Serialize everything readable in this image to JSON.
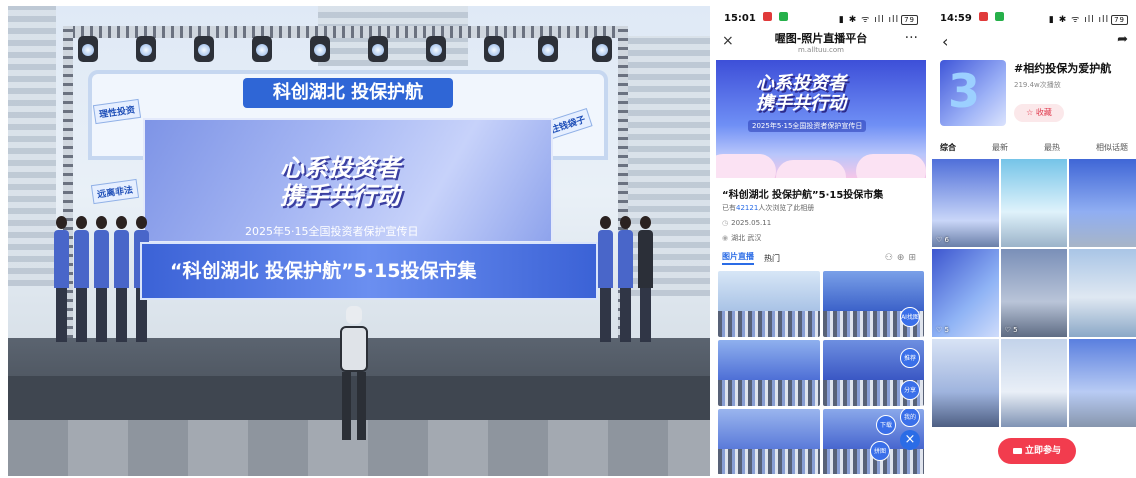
{
  "event_photo": {
    "arch_sign": "科创湖北 投保护航",
    "backdrop_title_line1": "心系投资者",
    "backdrop_title_line2": "携手共行动",
    "backdrop_subtitle": "2025年5·15全国投资者保护宣传日",
    "banner_text": "“科创湖北 投保护航”5·15投保市集",
    "side_tag_left_1": "理性投资",
    "side_tag_left_2": "远离非法",
    "side_tag_right": "守住钱袋子"
  },
  "phone_mid": {
    "status": {
      "time": "15:01",
      "battery": "79"
    },
    "nav": {
      "title": "喔图-照片直播平台",
      "url": "m.alltuu.com",
      "close": "×",
      "more": "···"
    },
    "hero": {
      "title_line1": "心系投资者",
      "title_line2": "携手共行动",
      "subtitle": "2025年5·15全国投资者保护宣传日"
    },
    "album": {
      "title": "“科创湖北 投保护航”5·15投保市集",
      "views_prefix": "已有",
      "views_count": "42121",
      "views_suffix": "人次浏览了此相册",
      "date": "2025.05.11",
      "location": "湖北 武汉"
    },
    "tabs": [
      {
        "label": "图片直播",
        "active": true
      },
      {
        "label": "热门",
        "active": false
      }
    ],
    "cell_badges": [
      "AI找图",
      "推荐",
      "分享",
      "下载",
      "拼图",
      "我的"
    ],
    "fab_close": "×"
  },
  "phone_right": {
    "status": {
      "time": "14:59",
      "battery": "79"
    },
    "topic": {
      "name": "#相约投保为爱护航",
      "plays": "219.4w次播放",
      "fav": "收藏"
    },
    "tabs": [
      {
        "label": "综合",
        "active": true
      },
      {
        "label": "最新",
        "active": false
      },
      {
        "label": "最热",
        "active": false
      },
      {
        "label": "相似话题",
        "active": false
      }
    ],
    "likes": [
      "6",
      "",
      "",
      "5",
      "5",
      ""
    ],
    "join_button": "立即参与"
  }
}
